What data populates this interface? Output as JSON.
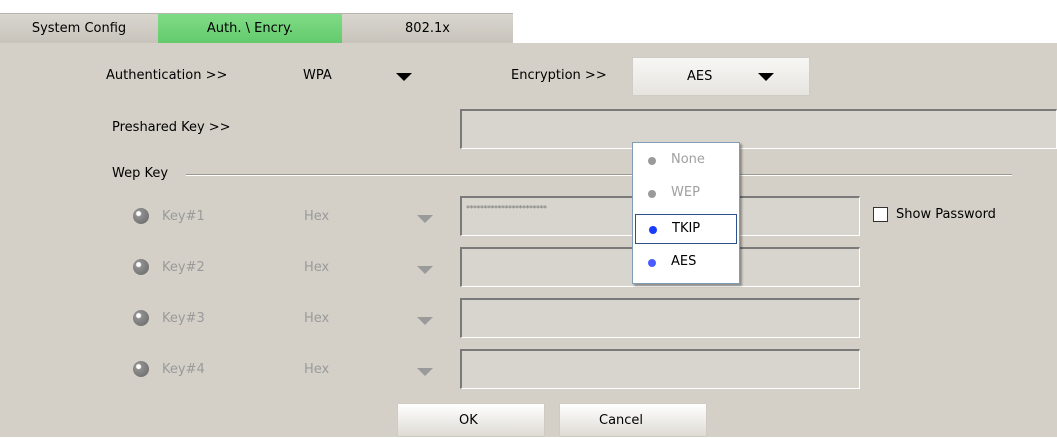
{
  "tabs": [
    {
      "label": "System Config"
    },
    {
      "label": "Auth. \\ Encry."
    },
    {
      "label": "802.1x"
    }
  ],
  "auth": {
    "label": "Authentication >>",
    "value": "WPA"
  },
  "encryption": {
    "label": "Encryption >>",
    "value": "AES",
    "options": [
      {
        "label": "None",
        "dot_color": "#9a9a9a"
      },
      {
        "label": "WEP",
        "dot_color": "#9a9a9a"
      },
      {
        "label": "TKIP",
        "dot_color": "#1a3cff"
      },
      {
        "label": "AES",
        "dot_color": "#4a5cff"
      }
    ]
  },
  "preshared_key": {
    "label": "Preshared Key >>",
    "value": ""
  },
  "wep": {
    "group_label": "Wep Key",
    "keys": [
      {
        "label": "Key#1",
        "format": "Hex",
        "value": "***********************"
      },
      {
        "label": "Key#2",
        "format": "Hex",
        "value": ""
      },
      {
        "label": "Key#3",
        "format": "Hex",
        "value": ""
      },
      {
        "label": "Key#4",
        "format": "Hex",
        "value": ""
      }
    ]
  },
  "show_password": {
    "label": "Show Password",
    "checked": false
  },
  "buttons": {
    "ok": "OK",
    "cancel": "Cancel"
  }
}
